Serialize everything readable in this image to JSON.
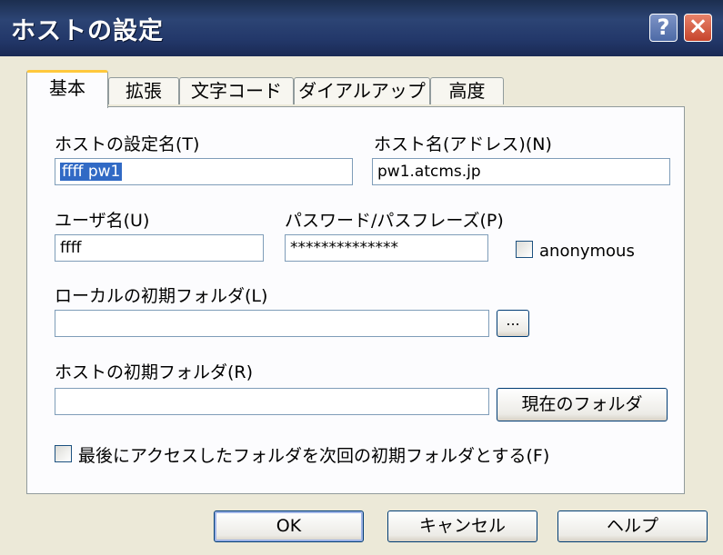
{
  "window": {
    "title": "ホストの設定",
    "help_button": "?",
    "close_button": "×"
  },
  "tabs": [
    {
      "label": "基本"
    },
    {
      "label": "拡張"
    },
    {
      "label": "文字コード"
    },
    {
      "label": "ダイアルアップ"
    },
    {
      "label": "高度"
    }
  ],
  "form": {
    "host_setting_name": {
      "label": "ホストの設定名(T)",
      "value": "ffff pw1"
    },
    "host_name": {
      "label": "ホスト名(アドレス)(N)",
      "value": "pw1.atcms.jp"
    },
    "username": {
      "label": "ユーザ名(U)",
      "value": "ffff"
    },
    "password": {
      "label": "パスワード/パスフレーズ(P)",
      "value": "**************"
    },
    "anonymous": {
      "label": "anonymous",
      "checked": false
    },
    "local_folder": {
      "label": "ローカルの初期フォルダ(L)",
      "value": "",
      "browse_label": "..."
    },
    "host_folder": {
      "label": "ホストの初期フォルダ(R)",
      "value": "",
      "current_folder_label": "現在のフォルダ"
    },
    "remember_last_folder": {
      "label": "最後にアクセスしたフォルダを次回の初期フォルダとする(F)",
      "checked": false
    }
  },
  "buttons": {
    "ok": "OK",
    "cancel": "キャンセル",
    "help": "ヘルプ"
  }
}
